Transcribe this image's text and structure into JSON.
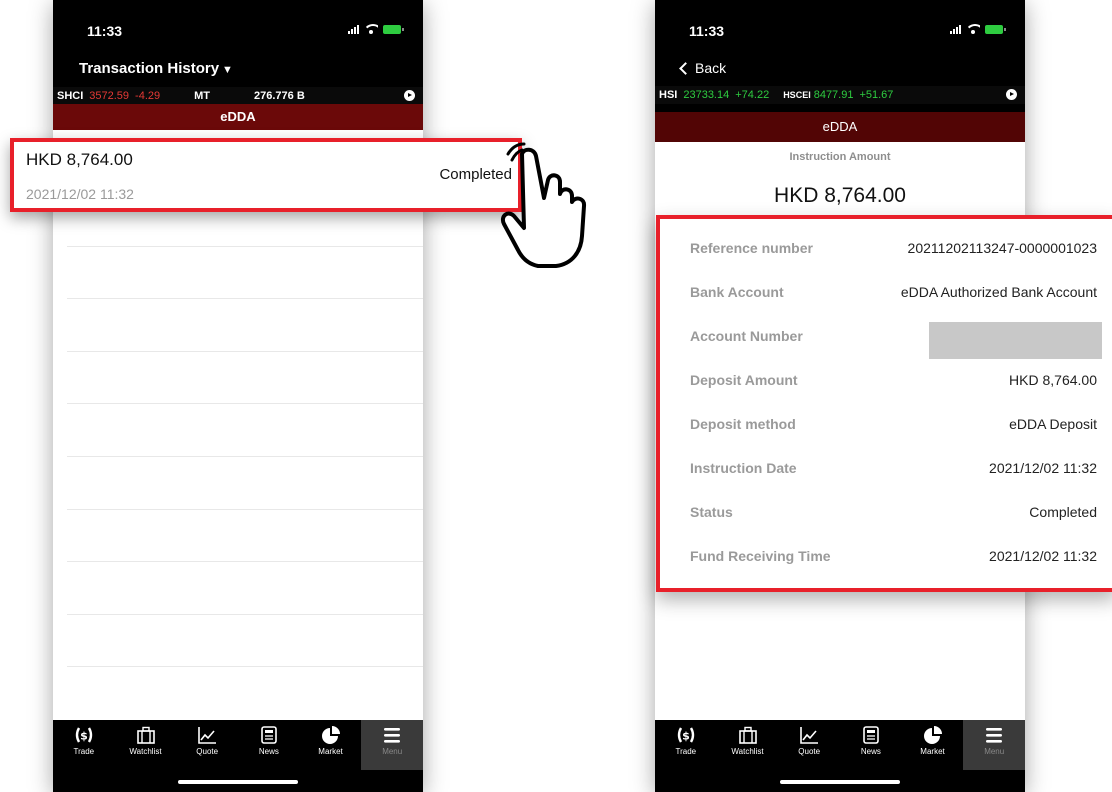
{
  "left_screen": {
    "time": "11:33",
    "title": "Transaction History",
    "caret": "▼",
    "ticker": {
      "code1": "SHCI",
      "value1": "3572.59",
      "change1": "-4.29",
      "code2": "MT",
      "turnover": "276.776 B"
    },
    "tab": "eDDA",
    "transaction": {
      "amount": "HKD 8,764.00",
      "date": "2021/12/02 11:32",
      "status": "Completed"
    }
  },
  "right_screen": {
    "time": "11:33",
    "back_label": "Back",
    "ticker": {
      "code1": "HSI",
      "value1": "23733.14",
      "change1": "+74.22",
      "code2": "HSCEI",
      "value2": "8477.91",
      "change2": "+51.67"
    },
    "tab": "eDDA",
    "instruction_amount_label": "Instruction Amount",
    "instruction_amount": "HKD 8,764.00",
    "details": [
      {
        "label": "Reference number",
        "value": "20211202113247-0000001023"
      },
      {
        "label": "Bank Account",
        "value": "eDDA Authorized Bank Account"
      },
      {
        "label": "Account Number",
        "value": ""
      },
      {
        "label": "Deposit Amount",
        "value": "HKD 8,764.00"
      },
      {
        "label": "Deposit method",
        "value": "eDDA Deposit"
      },
      {
        "label": "Instruction Date",
        "value": "2021/12/02 11:32"
      },
      {
        "label": "Status",
        "value": "Completed"
      },
      {
        "label": "Fund Receiving Time",
        "value": "2021/12/02 11:32"
      }
    ]
  },
  "bottom_tabs": [
    {
      "label": "Trade",
      "icon": "dollar-icon"
    },
    {
      "label": "Watchlist",
      "icon": "briefcase-icon"
    },
    {
      "label": "Quote",
      "icon": "line-chart-icon"
    },
    {
      "label": "News",
      "icon": "newspaper-icon"
    },
    {
      "label": "Market",
      "icon": "pie-chart-icon"
    },
    {
      "label": "Menu",
      "icon": "menu-icon",
      "active": true
    }
  ],
  "colors": {
    "highlight": "#e8202a",
    "tab_band": "#6b0909",
    "up": "#2ecc40",
    "down": "#e53935"
  }
}
